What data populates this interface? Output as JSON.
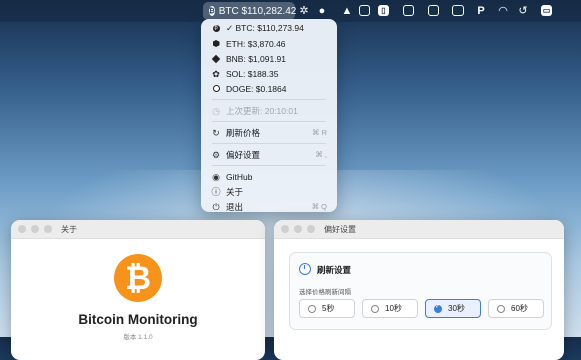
{
  "menubar": {
    "btc_label": "BTC $110,282.42",
    "btc_icon": "₿",
    "tray_icons": [
      "gear-icon",
      "wechat-icon",
      "qq-icon",
      "sidebar-icon",
      "clipboard-icon",
      "photos-icon",
      "app-icon",
      "card-icon",
      "p-icon",
      "wifi-icon",
      "history-icon",
      "display-icon"
    ]
  },
  "menu": {
    "coins": [
      {
        "label": "✓ BTC: $110,273.94",
        "icon": "₿"
      },
      {
        "label": "ETH: $3,870.46"
      },
      {
        "label": "BNB: $1,091.91"
      },
      {
        "label": "SOL: $188.35"
      },
      {
        "label": "DOGE: $0.1864"
      }
    ],
    "last_update": "上次更新: 20:10:01",
    "refresh": {
      "label": "刷新价格",
      "shortcut": "⌘ R"
    },
    "preferences": {
      "label": "偏好设置",
      "shortcut": "⌘ ,"
    },
    "github": "GitHub",
    "about": "关于",
    "quit": {
      "label": "退出",
      "shortcut": "⌘ Q"
    }
  },
  "about_window": {
    "title": "关于",
    "logo_glyph": "₿",
    "app_name": "Bitcoin Monitoring",
    "version": "版本 1.1.0"
  },
  "prefs_window": {
    "title": "偏好设置",
    "section_title": "刷新设置",
    "subtitle": "选择价格刷新间隔",
    "options": [
      "5秒",
      "10秒",
      "30秒",
      "60秒"
    ],
    "selected": "30秒"
  },
  "colors": {
    "accent": "#3b7ddd",
    "bitcoin_orange": "#f7931a"
  }
}
